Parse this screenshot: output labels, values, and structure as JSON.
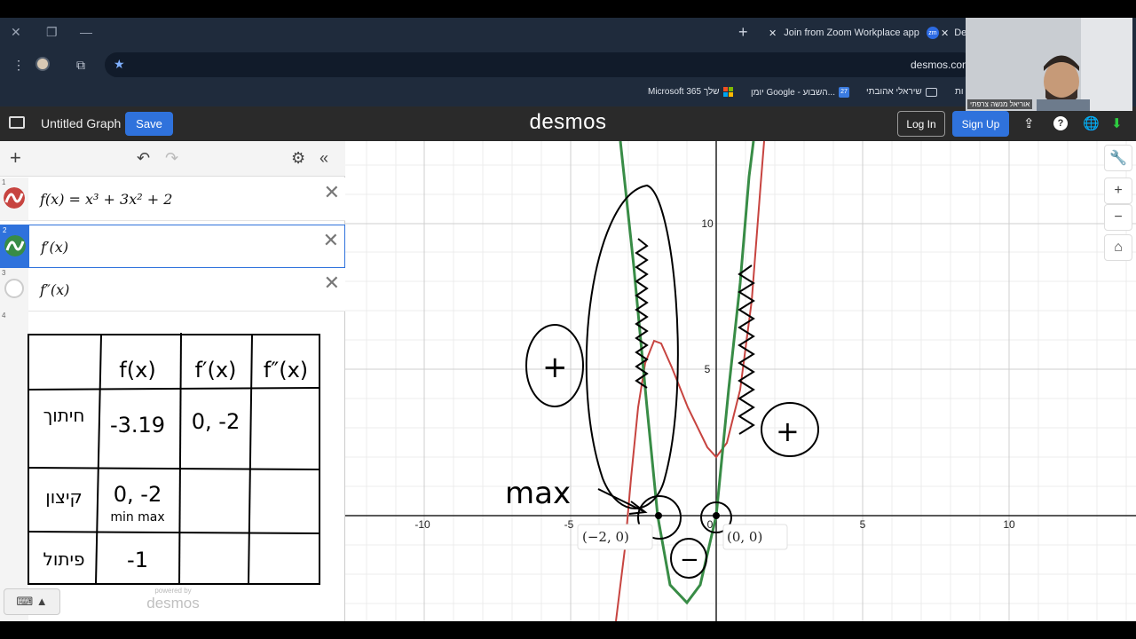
{
  "browser": {
    "tab_inactive_title": "Join from Zoom Workplace app",
    "tab_zoom_badge": "zm",
    "tab_active_title": "De",
    "url": "desmos.com",
    "bookmarks": [
      "Microsoft 365 שלך",
      "יומן Google - השבוע...",
      "שיראלי אהובתי",
      "ות"
    ],
    "calendar_day": "27"
  },
  "desmos": {
    "graph_title": "Untitled Graph",
    "save_label": "Save",
    "brand": "desmos",
    "login_label": "Log In",
    "signup_label": "Sign Up",
    "help_glyph": "?"
  },
  "expressions": [
    {
      "num": "1",
      "latex": "f(x) = x³ + 3x² + 2",
      "color": "#c74440",
      "icon": "curve-icon-red"
    },
    {
      "num": "2",
      "latex": "f′(x)",
      "color": "#388c46",
      "icon": "curve-icon-green"
    },
    {
      "num": "3",
      "latex": "f″(x)",
      "color": "#cccccc",
      "icon": "hidden-circle-icon"
    },
    {
      "num": "4",
      "latex": "",
      "color": "",
      "icon": ""
    }
  ],
  "handwritten_table": {
    "headers": [
      "",
      "f(x)",
      "f′(x)",
      "f″(x)"
    ],
    "rows": [
      {
        "label": "חיתוך",
        "cells": [
          "-3.19",
          "0, -2",
          ""
        ]
      },
      {
        "label": "קיצון",
        "cells": [
          "0, -2",
          "",
          ""
        ],
        "note": "min max"
      },
      {
        "label": "פיתול",
        "cells": [
          "-1",
          "",
          ""
        ]
      }
    ]
  },
  "powered_by": {
    "line1": "powered by",
    "line2": "desmos"
  },
  "keyboard_label": "⌨ ▲",
  "graph": {
    "x_ticks": [
      "-10",
      "-5",
      "0",
      "5",
      "10"
    ],
    "y_ticks": [
      "5",
      "10"
    ],
    "point_labels": [
      "(−2, 0)",
      "(0, 0)"
    ],
    "annotations": [
      "max",
      "+",
      "+",
      "−"
    ],
    "colors": {
      "f": "#c74440",
      "fprime": "#388c46",
      "ink": "#000000"
    }
  },
  "webcam": {
    "name_label": "אוריאל מנשה צרפתי"
  }
}
